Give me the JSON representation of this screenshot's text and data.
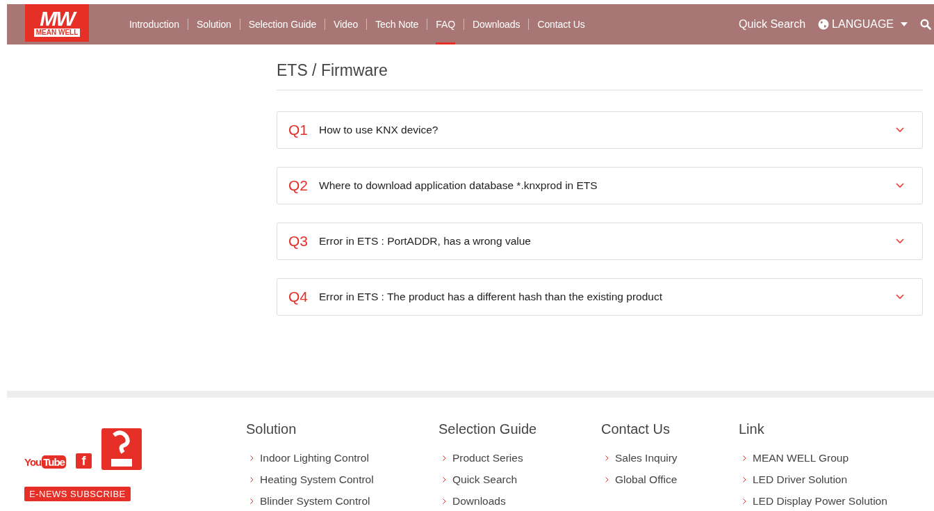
{
  "header": {
    "logo": {
      "mark": "MW",
      "name": "MEAN WELL"
    },
    "nav": [
      {
        "label": "Introduction",
        "selected": false
      },
      {
        "label": "Solution",
        "selected": false
      },
      {
        "label": "Selection Guide",
        "selected": false
      },
      {
        "label": "Video",
        "selected": false
      },
      {
        "label": "Tech Note",
        "selected": false
      },
      {
        "label": "FAQ",
        "selected": true
      },
      {
        "label": "Downloads",
        "selected": false
      },
      {
        "label": "Contact Us",
        "selected": false
      }
    ],
    "quick_search": "Quick Search",
    "language": "LANGUAGE"
  },
  "section": {
    "title": "ETS / Firmware",
    "faqs": [
      {
        "number": "Q1",
        "question": "How to use KNX device?",
        "expanded": false
      },
      {
        "number": "Q2",
        "question": "Where to download application database *.knxprod in ETS",
        "expanded": false
      },
      {
        "number": "Q3",
        "question": "Error in ETS : PortADDR, has a wrong value",
        "expanded": false
      },
      {
        "number": "Q4",
        "question": "Error in ETS : The product has a different hash than the existing product",
        "expanded": false
      }
    ]
  },
  "footer": {
    "youtube": {
      "you": "You",
      "tube": "Tube"
    },
    "facebook": "f",
    "subscribe": "E-NEWS SUBSCRIBE",
    "columns": [
      {
        "title": "Solution",
        "links": [
          "Indoor Lighting Control",
          "Heating System Control",
          "Blinder System Control"
        ]
      },
      {
        "title": "Selection Guide",
        "links": [
          "Product Series",
          "Quick Search",
          "Downloads"
        ]
      },
      {
        "title": "Contact Us",
        "links": [
          "Sales Inquiry",
          "Global Office"
        ]
      },
      {
        "title": "Link",
        "links": [
          "MEAN WELL Group",
          "LED Driver Solution",
          "LED Display Power Solution"
        ]
      }
    ]
  }
}
